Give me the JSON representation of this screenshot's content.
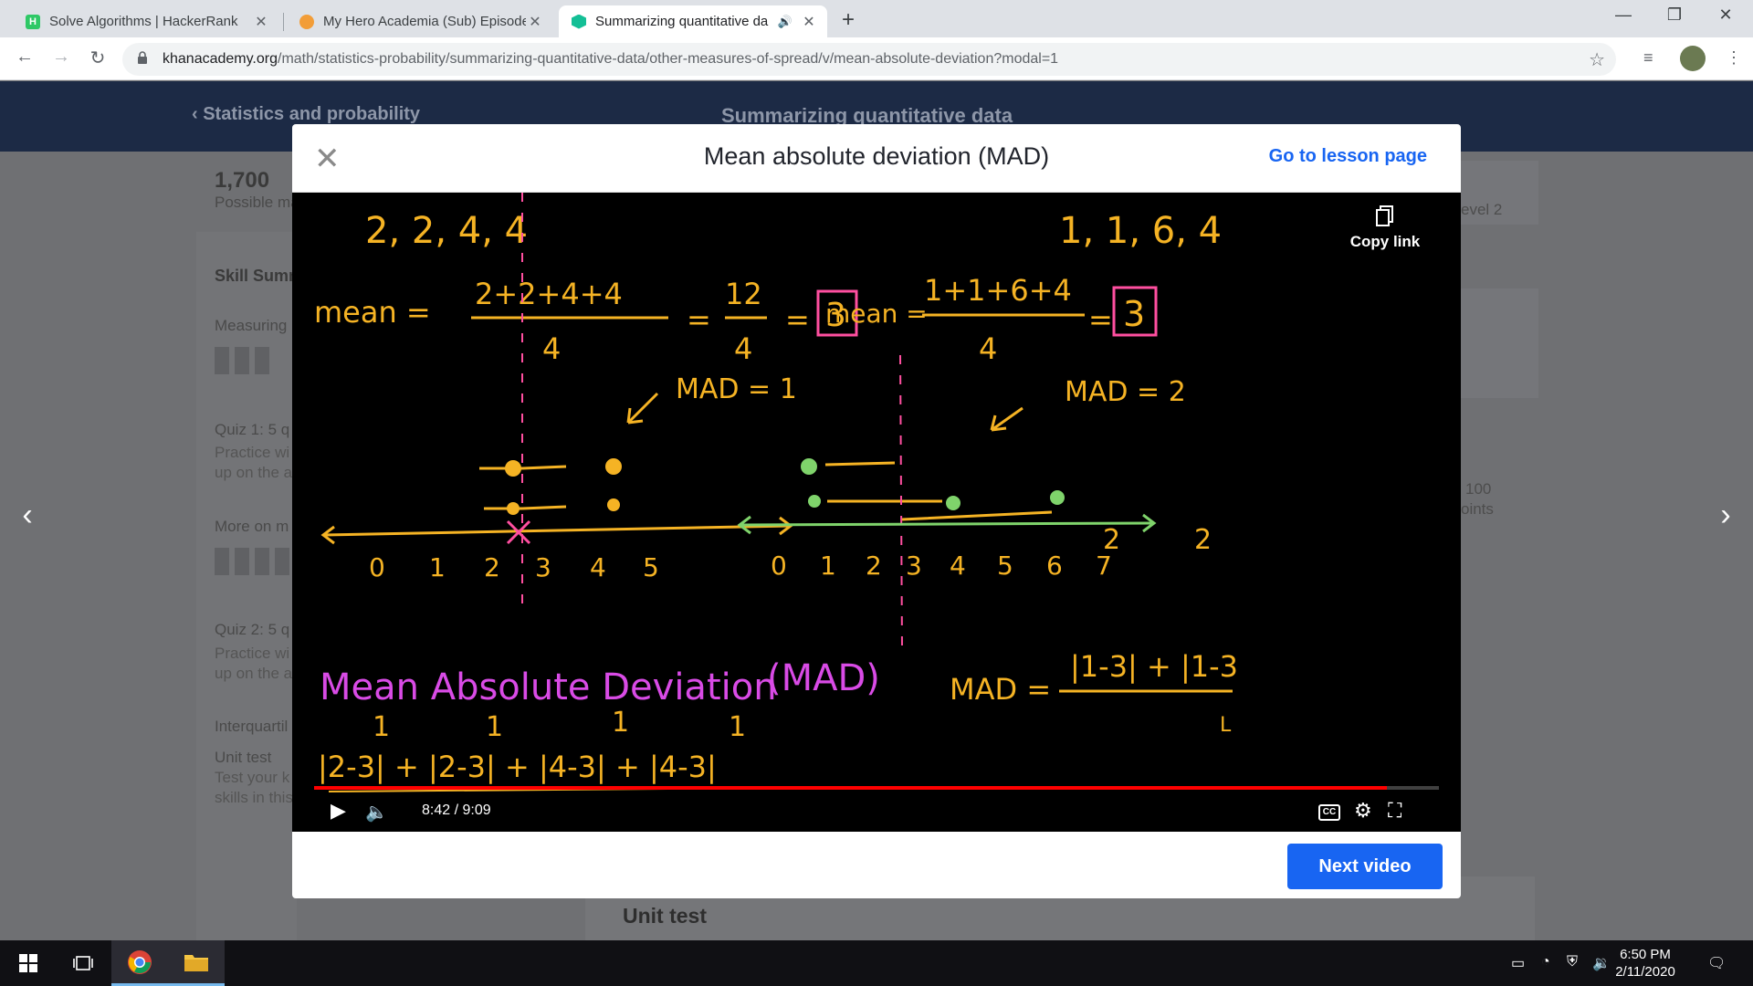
{
  "browser": {
    "tabs": [
      {
        "title": "Solve Algorithms | HackerRank",
        "favicon_color": "#2ec866",
        "favicon_letter": "H"
      },
      {
        "title": "My Hero Academia (Sub) Episode",
        "favicon_color": "#f29d38",
        "favicon_letter": ""
      },
      {
        "title": "Summarizing quantitative da",
        "favicon_color": "#14bf96",
        "favicon_letter": ""
      }
    ],
    "url_host": "khanacademy.org",
    "url_path": "/math/statistics-probability/summarizing-quantitative-data/other-measures-of-spread/v/mean-absolute-deviation?modal=1"
  },
  "page": {
    "back_label": "Statistics and probability",
    "course_title": "Summarizing quantitative data",
    "points_value": "1,700",
    "points_label": "Possible ma",
    "skill_summary": "Skill Sumn",
    "measuring": "Measuring",
    "quiz1_title": "Quiz 1: 5 q",
    "quiz1_desc1": "Practice wi",
    "quiz1_desc2": "up on the a",
    "more_on": "More on m",
    "quiz2_title": "Quiz 2: 5 q",
    "quiz2_desc1": "Practice wi",
    "quiz2_desc2": "up on the a",
    "interquartile": "Interquartil",
    "unit_test": "Unit test",
    "unit_test_desc1": "Test your k",
    "unit_test_desc2": "skills in this",
    "unit_test_card": "Unit test",
    "right_level": "evel 2",
    "right_points1": "100",
    "right_points2": "oints"
  },
  "modal": {
    "title": "Mean absolute deviation (MAD)",
    "lesson_link": "Go to lesson page",
    "copy_link": "Copy link",
    "time": "8:42 / 9:09",
    "progress": 0.954,
    "next_label": "Next video",
    "cc_label": "CC"
  },
  "board": {
    "left_data": "2, 2, 4, 4",
    "left_mean_label": "mean =",
    "left_mean_num": "2+2+4+4",
    "left_mean_den": "4",
    "left_eq1": "=",
    "left_frac_num": "12",
    "left_frac_den": "4",
    "left_eq2": "=",
    "left_mean": "3",
    "left_mad": "MAD = 1",
    "left_ticks": [
      "0",
      "1",
      "2",
      "3",
      "4",
      "5"
    ],
    "right_data": "1, 1, 6, 4",
    "right_mean_label": "mean =",
    "right_mean_num": "1+1+6+4",
    "right_mean_den": "4",
    "right_eq": "=",
    "right_mean": "3",
    "right_mad": "MAD = 2",
    "right_ticks": [
      "0",
      "1",
      "2",
      "3",
      "4",
      "5",
      "6",
      "7"
    ],
    "heading": "Mean Absolute Deviation",
    "heading_abbr": "(MAD)",
    "mad_formula_label": "MAD =",
    "mad_formula_num": "|1-3| + |1-3",
    "mad_top_marks": [
      "2",
      "2"
    ],
    "mad_den": "L",
    "bottom_expr": "|2-3| + |2-3| + |4-3| + |4-3|",
    "bottom_marks": [
      "1",
      "1",
      "1",
      "1"
    ]
  },
  "taskbar": {
    "time": "6:50 PM",
    "date": "2/11/2020"
  },
  "colors": {
    "chalk_yellow": "#f5b324",
    "chalk_green": "#7fd36b",
    "chalk_pink": "#ff4fa0",
    "chalk_magenta": "#d94be6",
    "khan_blue": "#1865f2",
    "header_navy": "#1c2a45"
  }
}
